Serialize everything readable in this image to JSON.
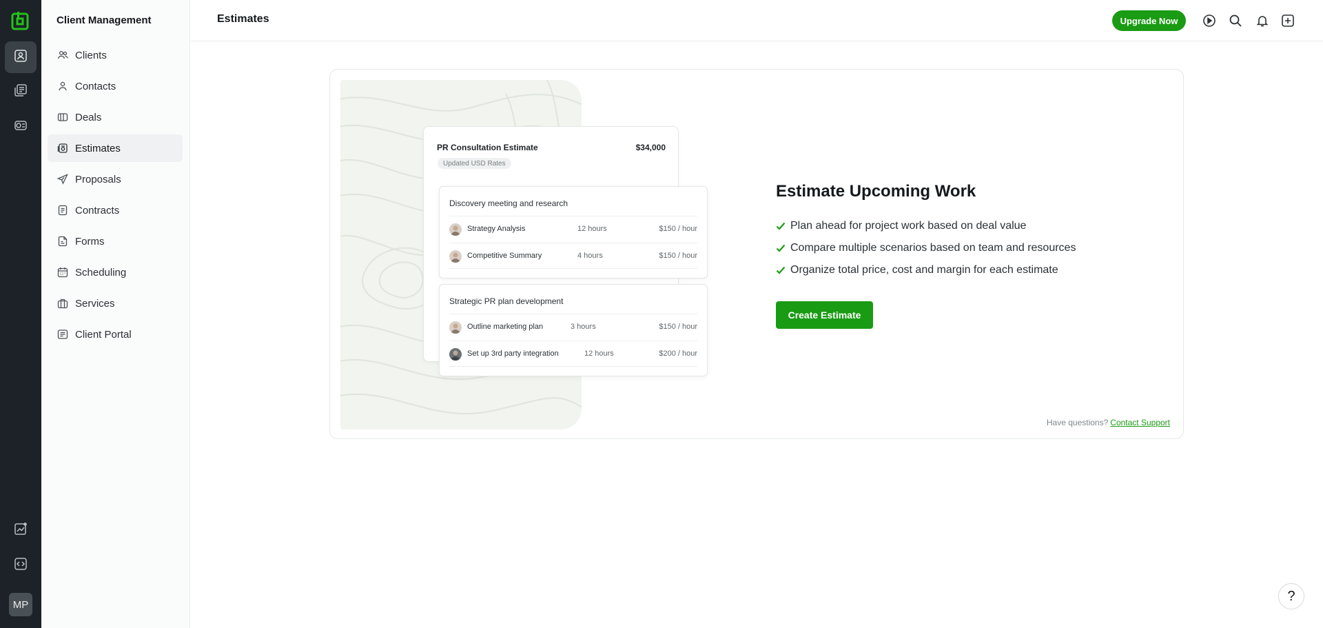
{
  "sidebar": {
    "title": "Client Management",
    "items": [
      {
        "label": "Clients",
        "icon": "users-icon"
      },
      {
        "label": "Contacts",
        "icon": "user-icon"
      },
      {
        "label": "Deals",
        "icon": "deals-icon"
      },
      {
        "label": "Estimates",
        "icon": "estimate-icon",
        "active": true
      },
      {
        "label": "Proposals",
        "icon": "send-icon"
      },
      {
        "label": "Contracts",
        "icon": "document-icon"
      },
      {
        "label": "Forms",
        "icon": "form-icon"
      },
      {
        "label": "Scheduling",
        "icon": "calendar-icon"
      },
      {
        "label": "Services",
        "icon": "briefcase-icon"
      },
      {
        "label": "Client Portal",
        "icon": "portal-icon"
      }
    ]
  },
  "rail": {
    "avatar_initials": "MP"
  },
  "header": {
    "title": "Estimates",
    "upgrade_label": "Upgrade Now"
  },
  "preview": {
    "title": "PR Consultation Estimate",
    "amount": "$34,000",
    "badge": "Updated USD Rates",
    "sections": [
      {
        "title": "Discovery meeting and research",
        "rows": [
          {
            "name": "Strategy Analysis",
            "hours": "12 hours",
            "rate": "$150 / hour"
          },
          {
            "name": "Competitive Summary",
            "hours": "4 hours",
            "rate": "$150 / hour"
          }
        ]
      },
      {
        "title": "Strategic PR plan development",
        "rows": [
          {
            "name": "Outline marketing plan",
            "hours": "3 hours",
            "rate": "$150 / hour"
          },
          {
            "name": "Set up 3rd party integration",
            "hours": "12 hours",
            "rate": "$200 / hour"
          }
        ]
      }
    ]
  },
  "feature": {
    "heading": "Estimate Upcoming Work",
    "bullets": [
      "Plan ahead for project work based on deal value",
      "Compare multiple scenarios based on team and resources",
      "Organize total price, cost and margin for each estimate"
    ],
    "cta_label": "Create Estimate"
  },
  "support": {
    "question": "Have questions?",
    "link_label": "Contact Support"
  },
  "help_label": "?",
  "colors": {
    "brand_green": "#1a9b14",
    "rail_bg": "#1c2227",
    "sidebar_bg": "#fafbfb"
  }
}
